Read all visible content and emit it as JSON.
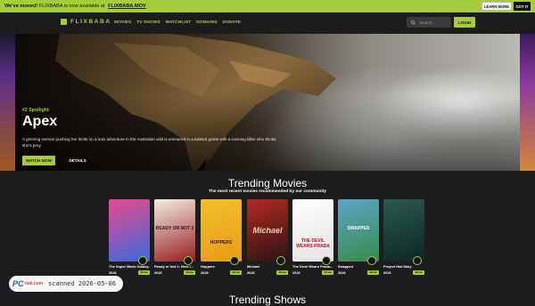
{
  "banner": {
    "pre": "We've moved!",
    "mid": "FLIXBABA is now available at",
    "link": "FLIXBABA.MOV",
    "learn": "LEARN MORE",
    "gotit": "GOT IT"
  },
  "nav": {
    "logo": "FLIXBABA",
    "links": [
      "MOVIES",
      "TV SHOWS",
      "WATCHLIST",
      "DOMAINS",
      "DONATE"
    ],
    "search_placeholder": "Search...",
    "login": "LOGIN"
  },
  "hero": {
    "spotlight": "#2 Spotlight",
    "title": "Apex",
    "description": "A grieving woman pushing her limits on a solo adventure in the Australian wild is ensnared in a twisted game with a cunning killer who thinks she's prey.",
    "watch": "WATCH NOW",
    "details": "DETAILS"
  },
  "trending": {
    "title": "Trending Movies",
    "subtitle": "The most recent movies recommended by our community",
    "cards": [
      {
        "title": "The Super Mario Galaxy...",
        "year": "2026",
        "type": "Movie",
        "colors": [
          "#e84a8a",
          "#3a6ae0"
        ]
      },
      {
        "title": "Ready or Not 2: Here I...",
        "year": "2026",
        "type": "Movie",
        "colors": [
          "#f2eee6",
          "#9a1e1e"
        ],
        "poster_text": "READY OR NOT 2"
      },
      {
        "title": "Hoppers",
        "year": "2026",
        "type": "Movie",
        "colors": [
          "#f3c12a",
          "#e89a18"
        ],
        "poster_text": "HOPPERS"
      },
      {
        "title": "Michael",
        "year": "2026",
        "type": "Movie",
        "colors": [
          "#b32a22",
          "#2a1414"
        ],
        "poster_text": "Michael"
      },
      {
        "title": "The Devil Wears Prada...",
        "year": "2026",
        "type": "Movie",
        "colors": [
          "#ffffff",
          "#e2e2e2"
        ],
        "poster_text": "THE DEVIL WEARS PRADA"
      },
      {
        "title": "Swapped",
        "year": "2026",
        "type": "Movie",
        "colors": [
          "#5aa6c8",
          "#3a8a4a"
        ],
        "poster_text": "SWAPPED"
      },
      {
        "title": "Project Hail Mary",
        "year": "2026",
        "type": "Movie",
        "colors": [
          "#2a5a4e",
          "#0e2622"
        ]
      }
    ]
  },
  "watermark": {
    "logo": "PC",
    "sub": "risk.com",
    "text": "scanned 2026-05-06"
  },
  "next_section": "Trending Shows"
}
